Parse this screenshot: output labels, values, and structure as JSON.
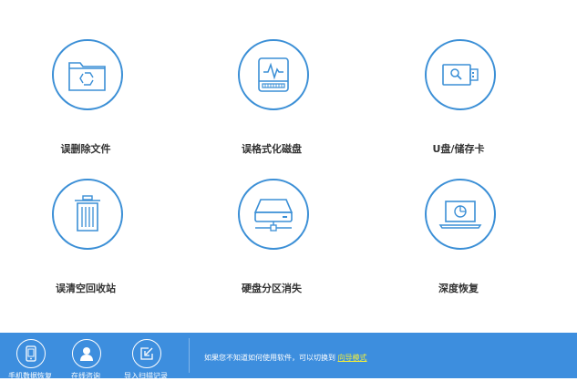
{
  "colors": {
    "accent": "#3b8fd6",
    "bottom_bar": "#3d8ede",
    "link": "#f3ee3a"
  },
  "tiles": [
    {
      "label": "误删除文件",
      "icon": "folder-recycle-icon"
    },
    {
      "label": "误格式化磁盘",
      "icon": "disk-drive-icon"
    },
    {
      "label": "U盘/储存卡",
      "icon": "usb-drive-icon"
    },
    {
      "label": "误清空回收站",
      "icon": "trash-bin-icon"
    },
    {
      "label": "硬盘分区消失",
      "icon": "hard-disk-network-icon"
    },
    {
      "label": "深度恢复",
      "icon": "laptop-scan-icon"
    }
  ],
  "bottom_bar": {
    "buttons": [
      {
        "label": "手机数据恢复",
        "icon": "phone-icon"
      },
      {
        "label": "在线咨询",
        "icon": "user-icon"
      },
      {
        "label": "导入扫描记录",
        "icon": "import-icon"
      }
    ],
    "hint_text": "如果您不知道如何使用软件，可以切换到",
    "hint_link": "向导模式"
  }
}
